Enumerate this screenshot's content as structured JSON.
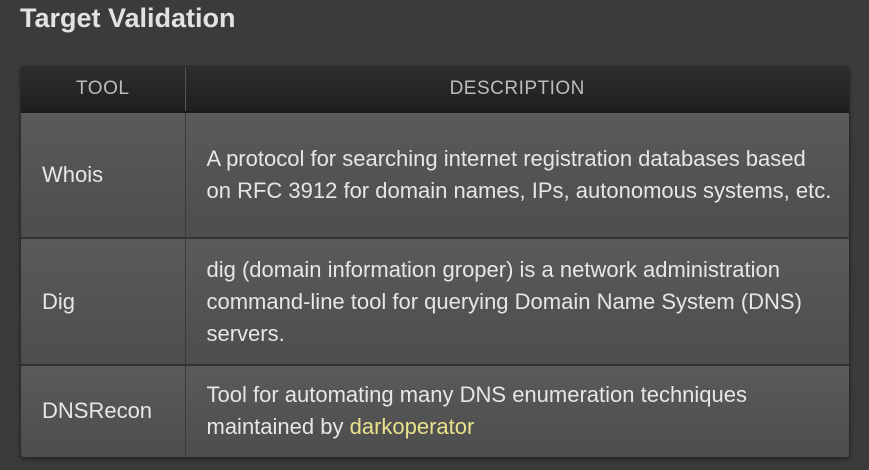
{
  "page": {
    "title": "Target Validation"
  },
  "table": {
    "headers": {
      "tool": "TOOL",
      "description": "DESCRIPTION"
    },
    "rows": [
      {
        "tool": "Whois",
        "description": "A protocol for searching internet registration databases based on RFC 3912 for domain names, IPs, autonomous systems, etc."
      },
      {
        "tool": "Dig",
        "description": "dig (domain information groper) is a network administration command-line tool for querying Domain Name System (DNS) servers."
      },
      {
        "tool": "DNSRecon",
        "description": "Tool for automating many DNS enumeration techniques maintained by ",
        "link_text": "darkoperator"
      }
    ]
  },
  "colors": {
    "background": "#3b3b3b",
    "header_bg": "#262626",
    "row_bg": "#535353",
    "text": "#e6e6e6",
    "link": "#e8e28a"
  }
}
